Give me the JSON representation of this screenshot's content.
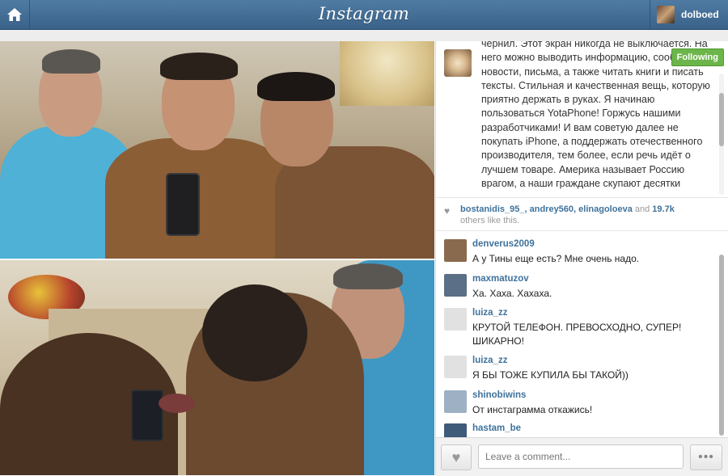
{
  "header": {
    "home_icon": "home-icon",
    "logo": "Instagram",
    "username": "dolboed"
  },
  "post": {
    "follow_label": "Following",
    "caption": "чернил. Этот экран никогда не выключается. На него можно выводить информацию, сообщения, новости, письма, а также читать книги и писать тексты. Стильная и качественная вещь, которую приятно держать в руках. Я начинаю пользоваться YotaPhone! Горжусь нашими разработчиками! И вам советую далее не покупать iPhone, а поддержать отечественного производителя, тем более, если речь идёт о лучшем товаре. Америка называет Россию врагом, а наши граждане скупают десятки",
    "likes": {
      "user1": "bostanidis_95_,",
      "user2": "andrey560",
      "user3": "elinagoloeva",
      "and_text": "and",
      "count": "19.7k",
      "others": "others like this."
    }
  },
  "comments": [
    {
      "user": "denverus2009",
      "text": "А у Тины еще есть? Мне очень надо.",
      "avatar_color": "#8a6a4e"
    },
    {
      "user": "maxmatuzov",
      "text": "Ха. Хаха. Хахаха.",
      "avatar_color": "#5b6f86"
    },
    {
      "user": "luiza_zz",
      "text": "КРУТОЙ ТЕЛЕФОН. ПРЕВОСХОДНО, СУПЕР! ШИКАРНО!",
      "avatar_color": "#e1e1e1"
    },
    {
      "user": "luiza_zz",
      "text": "Я БЫ ТОЖЕ КУПИЛА БЫ ТАКОЙ))",
      "avatar_color": "#e1e1e1"
    },
    {
      "user": "shinobiwins",
      "text": "От инстаграмма откажись!",
      "avatar_color": "#9db0c4"
    },
    {
      "user": "hastam_be",
      "text": "",
      "avatar_color": "#3e5b7a"
    }
  ],
  "footer": {
    "comment_placeholder": "Leave a comment...",
    "more_label": "•••"
  }
}
